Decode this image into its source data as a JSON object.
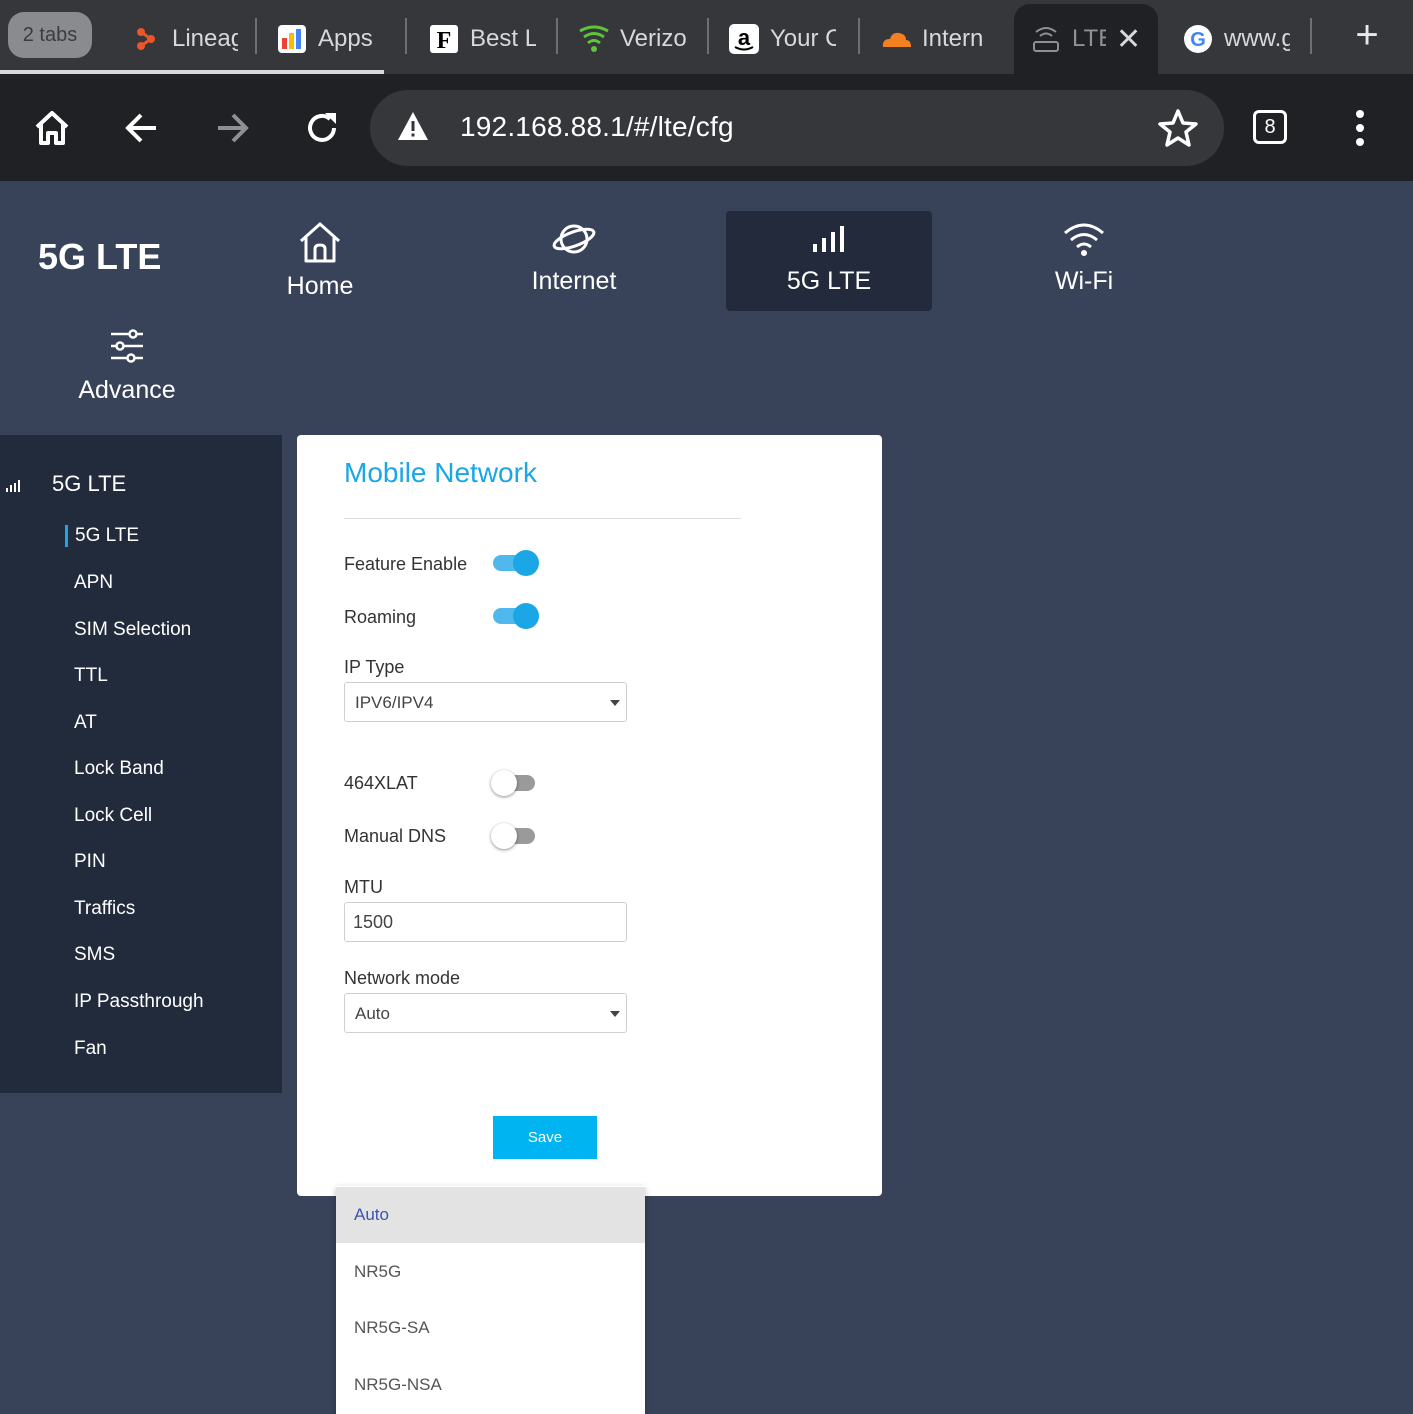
{
  "browser": {
    "tab_count_label": "2 tabs",
    "tabs": [
      {
        "label": "Lineag",
        "icon": "lineage-favicon-icon"
      },
      {
        "label": "Apps",
        "icon": "apps-favicon-icon"
      },
      {
        "label": "Best L",
        "icon": "forbes-favicon-icon"
      },
      {
        "label": "Verizo",
        "icon": "verizon-favicon-icon"
      },
      {
        "label": "Your C",
        "icon": "amazon-favicon-icon"
      },
      {
        "label": "Intern",
        "icon": "cloudflare-favicon-icon"
      },
      {
        "label": "LTE",
        "icon": "router-favicon-icon",
        "active": true
      },
      {
        "label": "www.g",
        "icon": "google-favicon-icon"
      }
    ],
    "url": "192.168.88.1/#/lte/cfg",
    "open_tabs": "8"
  },
  "app": {
    "brand": "5G LTE",
    "nav": [
      {
        "label": "Home",
        "icon": "home-icon"
      },
      {
        "label": "Internet",
        "icon": "planet-icon"
      },
      {
        "label": "5G LTE",
        "icon": "signal-bars-icon",
        "active": true
      },
      {
        "label": "Wi-Fi",
        "icon": "wifi-icon"
      },
      {
        "label": "Advance",
        "icon": "sliders-icon"
      }
    ]
  },
  "sidebar": {
    "group": "5G LTE",
    "items": [
      "5G LTE",
      "APN",
      "SIM Selection",
      "TTL",
      "AT",
      "Lock Band",
      "Lock Cell",
      "PIN",
      "Traffics",
      "SMS",
      "IP Passthrough",
      "Fan"
    ],
    "active_item": "5G LTE"
  },
  "form": {
    "title": "Mobile Network",
    "feature_enable": {
      "label": "Feature Enable",
      "on": true
    },
    "roaming": {
      "label": "Roaming",
      "on": true
    },
    "ip_type": {
      "label": "IP Type",
      "value": "IPV6/IPV4"
    },
    "xlat": {
      "label": "464XLAT",
      "on": false
    },
    "manual_dns": {
      "label": "Manual DNS",
      "on": false
    },
    "mtu": {
      "label": "MTU",
      "value": "1500"
    },
    "network_mode": {
      "label": "Network mode",
      "value": "Auto"
    },
    "save_label": "Save"
  },
  "dropdown": {
    "options": [
      "Auto",
      "NR5G",
      "NR5G-SA",
      "NR5G-NSA"
    ],
    "selected": "Auto"
  },
  "colors": {
    "accent": "#1ba6e6",
    "page_bg": "#384259",
    "sidebar_bg": "#222b3c",
    "save_button": "#00b4f1"
  }
}
